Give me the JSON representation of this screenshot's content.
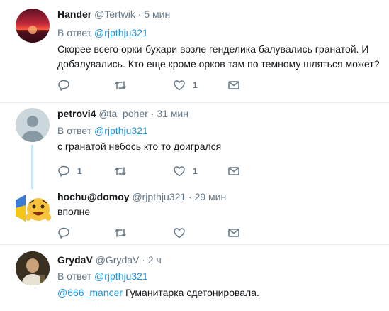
{
  "tweets": [
    {
      "name": "Hander",
      "handle": "@Tertwik",
      "sep": "·",
      "time": "5 мин",
      "reply_prefix": "В ответ",
      "reply_to": "@rjpthju321",
      "text": "Скорее всего орки-бухари возле генделика балувались гранатой. И добалувались. Кто еще кроме орков там по темному шляться может?",
      "counts": {
        "reply": "",
        "retweet": "",
        "like": "1"
      }
    },
    {
      "name": "petrovi4",
      "handle": "@ta_poher",
      "sep": "·",
      "time": "31 мин",
      "reply_prefix": "В ответ",
      "reply_to": "@rjpthju321",
      "text": "с гранатой небось кто то доигрался",
      "counts": {
        "reply": "1",
        "retweet": "",
        "like": "1"
      }
    },
    {
      "name": "hochu@domoy",
      "handle": "@rjpthju321",
      "sep": "·",
      "time": "29 мин",
      "text": "вполне",
      "counts": {
        "reply": "",
        "retweet": "",
        "like": ""
      }
    },
    {
      "name": "GrydaV",
      "handle": "@GrydaV",
      "sep": "·",
      "time": "2 ч",
      "reply_prefix": "В ответ",
      "reply_to": "@rjpthju321",
      "mention": "@666_mancer",
      "text": "Гуманитарка сдетонировала."
    }
  ],
  "colors": {
    "accent": "#1b95e0",
    "muted": "#657786",
    "text": "#14171a",
    "divider": "#e6ecf0",
    "thread_line": "#c4e7f8"
  },
  "icons": [
    "reply-icon",
    "retweet-icon",
    "like-icon",
    "message-icon"
  ]
}
